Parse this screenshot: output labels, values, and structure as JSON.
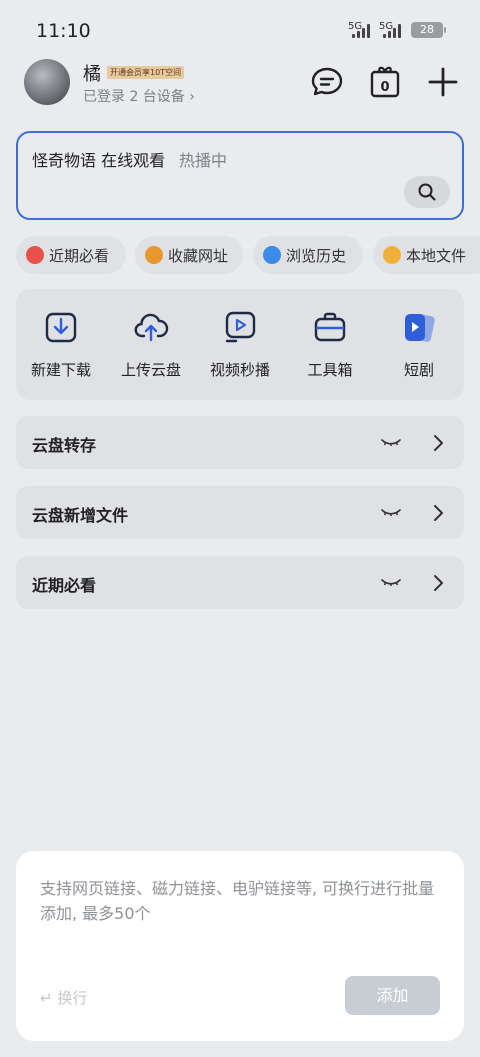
{
  "status": {
    "time": "11:10",
    "net1": "5G",
    "net2": "5G",
    "battery": "28"
  },
  "user": {
    "name": "橘",
    "vip_badge": "开通会员享10T空间",
    "devices": "已登录 2 台设备 ›"
  },
  "search": {
    "query": "怪奇物语 在线观看",
    "hint": "热播中"
  },
  "chips": [
    {
      "label": "近期必看",
      "color": "#e8504a"
    },
    {
      "label": "收藏网址",
      "color": "#e8962e"
    },
    {
      "label": "浏览历史",
      "color": "#3d8be8"
    },
    {
      "label": "本地文件",
      "color": "#f0b03a"
    }
  ],
  "tools": [
    {
      "label": "新建下载",
      "icon": "download-icon"
    },
    {
      "label": "上传云盘",
      "icon": "cloud-upload-icon"
    },
    {
      "label": "视频秒播",
      "icon": "video-play-icon"
    },
    {
      "label": "工具箱",
      "icon": "toolbox-icon"
    },
    {
      "label": "短剧",
      "icon": "short-drama-icon"
    }
  ],
  "sections": [
    {
      "label": "云盘转存"
    },
    {
      "label": "云盘新增文件"
    },
    {
      "label": "近期必看"
    }
  ],
  "sheet": {
    "placeholder": "支持网页链接、磁力链接、电驴链接等, 可换行进行批量添加, 最多50个",
    "newline_label": "↵ 换行",
    "add_label": "添加"
  },
  "colors": {
    "accent": "#3f6fd6",
    "tool_icon": "#1f2a44",
    "short_drama": "#2f5fd8"
  }
}
